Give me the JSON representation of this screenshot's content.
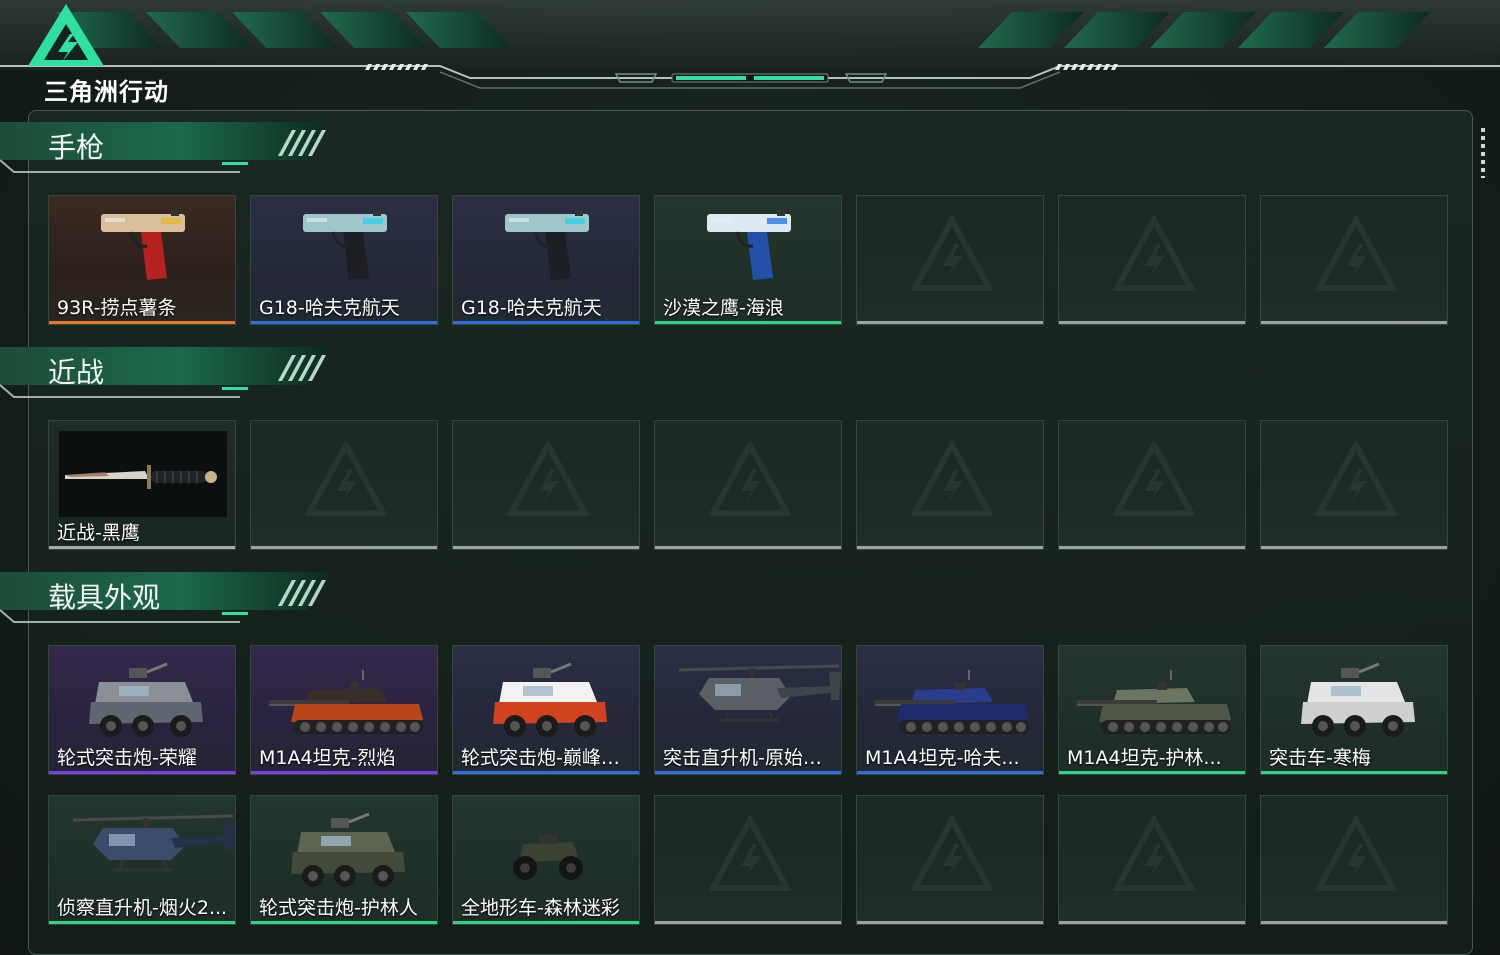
{
  "header": {
    "logo_text": "三角洲行动",
    "accent": "#2fe0a0"
  },
  "sections": [
    {
      "title": "手枪",
      "items": [
        {
          "name": "93R-捞点薯条",
          "rarity": "orange",
          "icon": "pistol-icon"
        },
        {
          "name": "G18-哈夫克航天",
          "rarity": "blue",
          "icon": "pistol-icon"
        },
        {
          "name": "G18-哈夫克航天",
          "rarity": "blue",
          "icon": "pistol-icon"
        },
        {
          "name": "沙漠之鹰-海浪",
          "rarity": "green",
          "icon": "pistol-icon"
        },
        {
          "name": "",
          "rarity": "empty"
        },
        {
          "name": "",
          "rarity": "empty"
        },
        {
          "name": "",
          "rarity": "empty"
        }
      ]
    },
    {
      "title": "近战",
      "items": [
        {
          "name": "近战-黑鹰",
          "rarity": "gray",
          "icon": "knife-icon"
        },
        {
          "name": "",
          "rarity": "empty"
        },
        {
          "name": "",
          "rarity": "empty"
        },
        {
          "name": "",
          "rarity": "empty"
        },
        {
          "name": "",
          "rarity": "empty"
        },
        {
          "name": "",
          "rarity": "empty"
        },
        {
          "name": "",
          "rarity": "empty"
        }
      ]
    },
    {
      "title": "载具外观",
      "items": [
        {
          "name": "轮式突击炮-荣耀",
          "rarity": "purple",
          "icon": "armored-car-icon"
        },
        {
          "name": "M1A4坦克-烈焰",
          "rarity": "purple",
          "icon": "tank-icon"
        },
        {
          "name": "轮式突击炮-巅峰竞...",
          "rarity": "blue",
          "icon": "armored-car-icon"
        },
        {
          "name": "突击直升机-原始伪...",
          "rarity": "blue",
          "icon": "helicopter-icon"
        },
        {
          "name": "M1A4坦克-哈夫...",
          "rarity": "blue",
          "icon": "tank-icon"
        },
        {
          "name": "M1A4坦克-护林...",
          "rarity": "green",
          "icon": "tank-icon"
        },
        {
          "name": "突击车-寒梅",
          "rarity": "green",
          "icon": "armored-car-icon"
        },
        {
          "name": "侦察直升机-烟火2...",
          "rarity": "green",
          "icon": "helicopter-icon"
        },
        {
          "name": "轮式突击炮-护林人",
          "rarity": "green",
          "icon": "armored-car-icon"
        },
        {
          "name": "全地形车-森林迷彩",
          "rarity": "green",
          "icon": "atv-icon"
        },
        {
          "name": "",
          "rarity": "empty"
        },
        {
          "name": "",
          "rarity": "empty"
        },
        {
          "name": "",
          "rarity": "empty"
        },
        {
          "name": "",
          "rarity": "empty"
        }
      ]
    }
  ],
  "rarity_colors": {
    "orange": "#e8752a",
    "blue": "#2f6ee0",
    "green": "#2ed38a",
    "purple": "#7a3fe6",
    "gray": "#a7aeaa",
    "empty": "#9aa39e"
  }
}
